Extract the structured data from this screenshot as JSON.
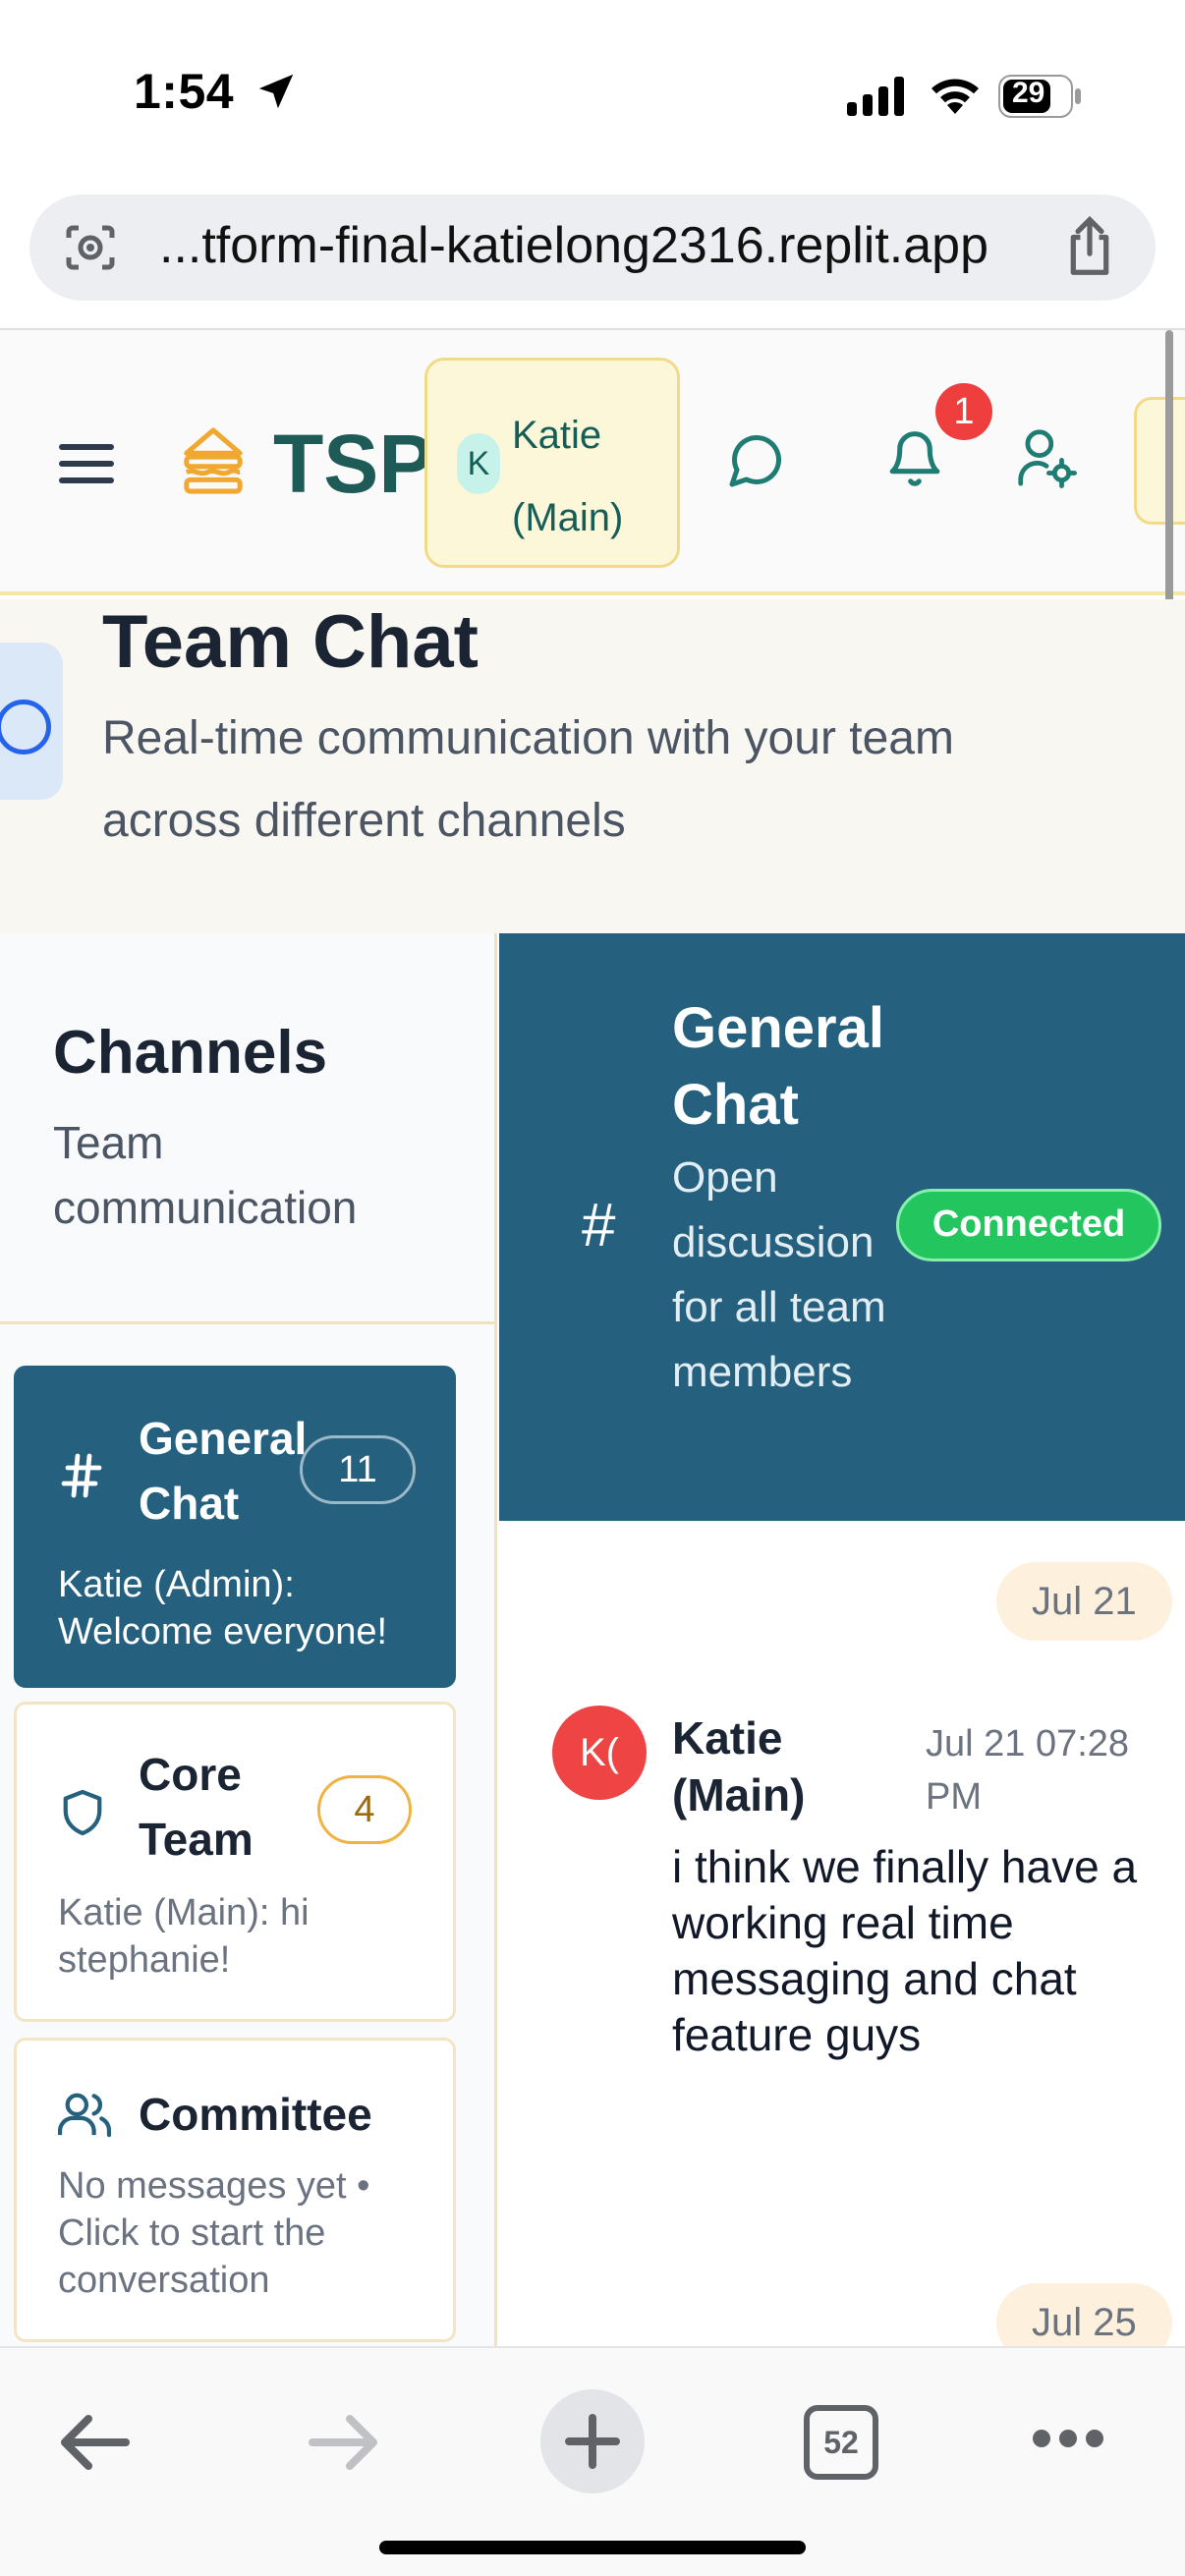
{
  "status_bar": {
    "time": "1:54",
    "battery": "29"
  },
  "browser": {
    "url": "...tform-final-katielong2316.replit.app",
    "tab_count": "52"
  },
  "header": {
    "brand": "TSP",
    "user_initial": "K",
    "user_name": "Katie (Main)",
    "notification_count": "1"
  },
  "intro": {
    "title": "Team Chat",
    "subtitle": "Real-time communication with your team across different channels"
  },
  "sidebar": {
    "title": "Channels",
    "subtitle": "Team communication",
    "channels": [
      {
        "name": "General Chat",
        "count": "11",
        "preview": "Katie (Admin): Welcome everyone!",
        "icon": "hash-icon",
        "active": true
      },
      {
        "name": "Core Team",
        "count": "4",
        "preview": "Katie (Main): hi stephanie!",
        "icon": "shield-icon",
        "active": false
      },
      {
        "name": "Committee",
        "count": "",
        "preview": "No messages yet • Click to start the conversation",
        "icon": "users-icon",
        "active": false
      }
    ]
  },
  "chat": {
    "title": "General Chat",
    "description": "Open discussion for all team members",
    "status": "Connected",
    "date_chips": [
      "Jul 21",
      "Jul 25"
    ],
    "messages": [
      {
        "avatar": "K(",
        "author": "Katie (Main)",
        "time": "Jul 21 07:28 PM",
        "text": "i think we finally have a working real time messaging and chat feature guys"
      }
    ]
  },
  "colors": {
    "brand": "#1e5b57",
    "channel_active": "#25617f",
    "connected": "#22c55e",
    "badge": "#ef3e3e",
    "accent_yellow": "#f1da8a"
  }
}
